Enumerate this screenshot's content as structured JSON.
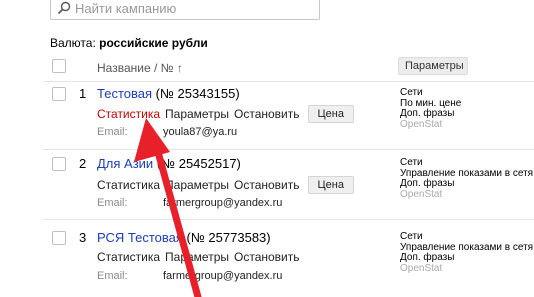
{
  "search": {
    "placeholder": "Найти кампанию"
  },
  "currency": {
    "label": "Валюта:",
    "value": "российские рубли"
  },
  "header": {
    "name_col": "Название / № ↑",
    "params_col": "Параметры"
  },
  "campaigns": [
    {
      "num": "1",
      "name": "Тестовая",
      "id": "(№ 25343155)",
      "links": {
        "stats": "Статистика",
        "params": "Параметры",
        "stop": "Остановить",
        "price": "Цена"
      },
      "email_label": "Email:",
      "email": "youla87@ya.ru",
      "params": [
        "Сети",
        "По мин. цене",
        "Доп. фразы",
        "OpenStat"
      ]
    },
    {
      "num": "2",
      "name": "Для Азии",
      "id": "(№ 25452517)",
      "links": {
        "stats": "Статистика",
        "params": "Параметры",
        "stop": "Остановить",
        "price": "Цена"
      },
      "email_label": "Email:",
      "email": "farmergroup@yandex.ru",
      "params": [
        "Сети",
        "Управление показами в сетя",
        "Доп. фразы",
        "OpenStat"
      ]
    },
    {
      "num": "3",
      "name": "РСЯ Тестовая",
      "id": "(№ 25773583)",
      "links": {
        "stats": "Статистика",
        "params": "Параметры",
        "stop": "Остановить"
      },
      "email_label": "Email:",
      "email": "farmergroup@yandex.ru",
      "params": [
        "Сети",
        "Управление показами в сетя",
        "Доп. фразы",
        "OpenStat"
      ]
    }
  ],
  "colors": {
    "link": "#1a3dc1",
    "active_link": "#cc0000",
    "arrow": "#e8202a"
  }
}
